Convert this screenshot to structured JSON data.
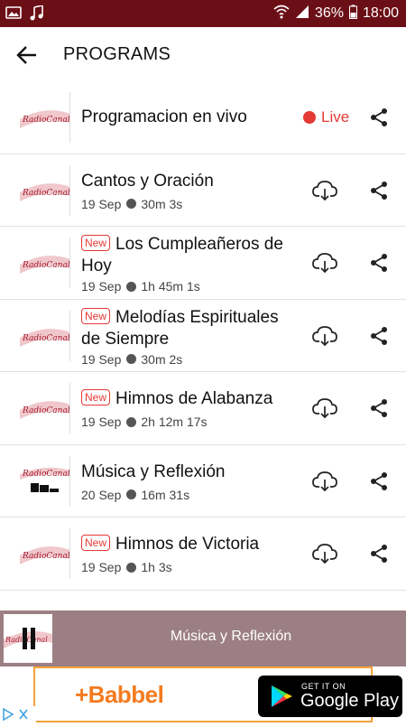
{
  "status_bar": {
    "battery": "36%",
    "time": "18:00"
  },
  "header": {
    "title": "PROGRAMS"
  },
  "programs": [
    {
      "title": "Programacion en vivo",
      "live_label": "Live"
    },
    {
      "title": "Cantos y Oración",
      "date": "19 Sep",
      "duration": "30m 3s"
    },
    {
      "title": "Los Cumpleañeros de Hoy",
      "badge": "New",
      "date": "19 Sep",
      "duration": "1h 45m 1s"
    },
    {
      "title": "Melodías Espirituales de Siempre",
      "badge": "New",
      "date": "19 Sep",
      "duration": "30m 2s"
    },
    {
      "title": "Himnos de Alabanza",
      "badge": "New",
      "date": "19 Sep",
      "duration": "2h 12m 17s"
    },
    {
      "title": "Música y Reflexión",
      "date": "20 Sep",
      "duration": "16m 31s"
    },
    {
      "title": "Himnos de Victoria",
      "badge": "New",
      "date": "19 Sep",
      "duration": "1h 3s"
    }
  ],
  "player": {
    "title": "Música y Reflexión"
  },
  "ad": {
    "brand": "+Babbel",
    "store_small": "GET IT ON",
    "store_big": "Google Play"
  },
  "colors": {
    "status_bar": "#6b0f16",
    "accent_red": "#e53935",
    "player_bg": "#9c7f84",
    "ad_border": "#f6a23a",
    "babbel_orange": "#f47b1f"
  },
  "icons": [
    "picture-icon",
    "music-note-icon",
    "wifi-icon",
    "signal-icon",
    "battery-icon",
    "back-arrow-icon",
    "download-icon",
    "share-icon",
    "pause-icon",
    "play-store-icon",
    "adchoices-icon"
  ]
}
